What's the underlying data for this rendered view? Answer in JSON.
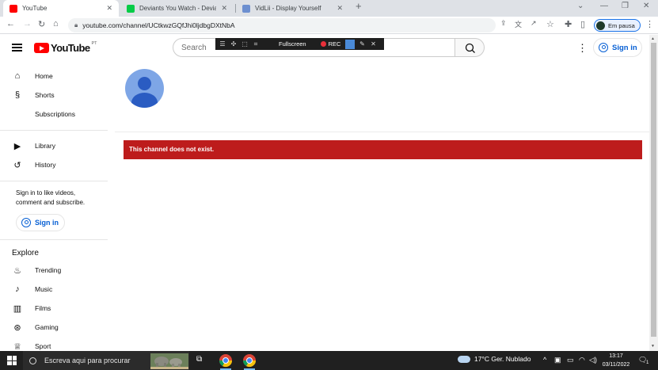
{
  "browser": {
    "tabs": [
      {
        "title": "YouTube",
        "active": true
      },
      {
        "title": "Deviants You Watch - Deviations",
        "active": false
      },
      {
        "title": "VidLii - Display Yourself",
        "active": false
      }
    ],
    "new_tab": "+",
    "url": "youtube.com/channel/UCtkwzGQfJhi0ljdbgDXtNbA",
    "profile_label": "Em pausa",
    "window_controls": [
      "⌄",
      "—",
      "❐",
      "✕"
    ]
  },
  "recorder": {
    "fullscreen_label": "Fullscreen",
    "rec_label": "REC"
  },
  "youtube": {
    "logo_text": "YouTube",
    "region": "PT",
    "search_placeholder": "Search",
    "sign_in_label": "Sign in",
    "sidebar": {
      "primary": [
        {
          "label": "Home",
          "icon": "home-icon"
        },
        {
          "label": "Shorts",
          "icon": "shorts-icon"
        },
        {
          "label": "Subscriptions",
          "icon": "subscriptions-icon"
        }
      ],
      "library": [
        {
          "label": "Library",
          "icon": "library-icon"
        },
        {
          "label": "History",
          "icon": "history-icon"
        }
      ],
      "signin_message": "Sign in to like videos, comment and subscribe.",
      "signin_label": "Sign in",
      "explore_title": "Explore",
      "explore": [
        {
          "label": "Trending",
          "icon": "trending-icon"
        },
        {
          "label": "Music",
          "icon": "music-icon"
        },
        {
          "label": "Films",
          "icon": "films-icon"
        },
        {
          "label": "Gaming",
          "icon": "gaming-icon"
        },
        {
          "label": "Sport",
          "icon": "sport-icon"
        }
      ]
    },
    "error_message": "This channel does not exist."
  },
  "taskbar": {
    "search_text": "Escreva aqui para procurar",
    "weather": "17°C  Ger. Nublado",
    "time": "13:17",
    "date": "03/11/2022",
    "notification_count": "1"
  },
  "colors": {
    "error_bg": "#bd1c1c",
    "link_blue": "#065fd4",
    "yt_red": "#ff0000"
  }
}
